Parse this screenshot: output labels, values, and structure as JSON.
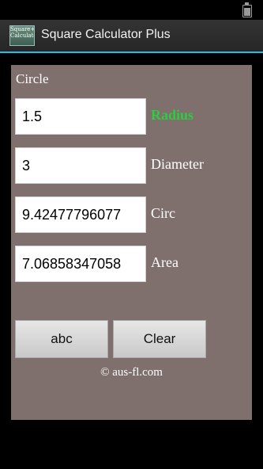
{
  "app": {
    "title": "Square Calculator Plus",
    "icon_text": "Square+ Calculator"
  },
  "section": {
    "label": "Circle"
  },
  "fields": [
    {
      "value": "1.5",
      "label": "Radius",
      "active": true
    },
    {
      "value": "3",
      "label": "Diameter",
      "active": false
    },
    {
      "value": "9.42477796077",
      "label": "Circ",
      "active": false
    },
    {
      "value": "7.06858347058",
      "label": "Area",
      "active": false
    }
  ],
  "buttons": {
    "abc": "abc",
    "clear": "Clear"
  },
  "footer": {
    "copyright": "© aus-fl.com"
  },
  "colors": {
    "accent": "#33b5e5",
    "active_label": "#2ecc40",
    "panel": "#7f6f6d"
  }
}
